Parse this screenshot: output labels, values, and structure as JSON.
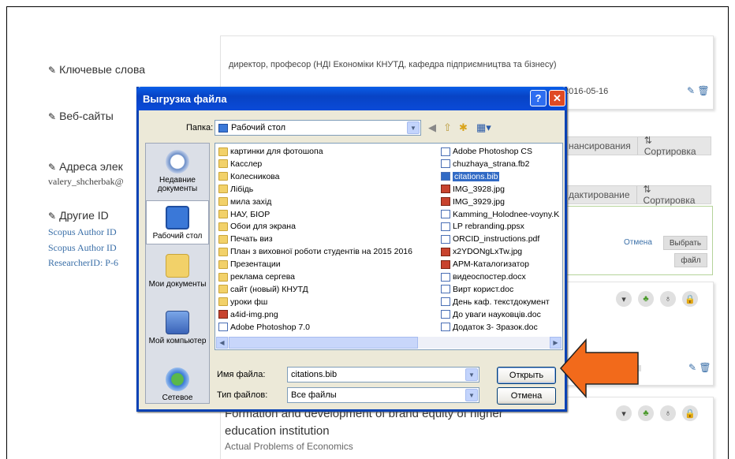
{
  "background": {
    "sections": {
      "keywords": "Ключевые слова",
      "websites": "Веб-сайты",
      "emails": "Адреса элек",
      "other_ids": "Другие ID"
    },
    "email_value": "valery_shcherbak@",
    "id_links": [
      "Scopus Author ID",
      "Scopus Author ID",
      "ResearcherID: P-6"
    ],
    "employment_text": "директор, професор (НДІ Економіки КНУТД, кафедра підприємництва та бізнесу)",
    "date_text": "2016-05-16",
    "funding_bar": {
      "left": "нансирования",
      "right": "⇅ Сортировка"
    },
    "works_bar": {
      "left": "дактирование",
      "right": "⇅ Сортировка"
    },
    "import_panel": {
      "cancel": "Отмена",
      "choose": "Выбрать",
      "file": "файл"
    },
    "paper": {
      "title_line1": "Formation and development of brand equity of higher",
      "title_line2": "education institution",
      "journal": "Actual Problems of Economics"
    }
  },
  "dialog": {
    "title": "Выгрузка файла",
    "help_glyph": "?",
    "close_glyph": "✕",
    "folder_label": "Папка:",
    "folder_value": "Рабочий стол",
    "places": [
      {
        "label": "Недавние документы",
        "icon": "recent-icon"
      },
      {
        "label": "Рабочий стол",
        "icon": "desktop-icon"
      },
      {
        "label": "Мои документы",
        "icon": "my-documents-icon"
      },
      {
        "label": "Мой компьютер",
        "icon": "my-computer-icon"
      },
      {
        "label": "Сетевое",
        "icon": "network-icon"
      }
    ],
    "files_col1": [
      {
        "name": "картинки для фотошопа",
        "type": "folder"
      },
      {
        "name": "Касслер",
        "type": "folder"
      },
      {
        "name": "Колесникова",
        "type": "folder"
      },
      {
        "name": "Лібідь",
        "type": "folder"
      },
      {
        "name": "мила захід",
        "type": "folder"
      },
      {
        "name": "НАУ, БІОР",
        "type": "folder"
      },
      {
        "name": "Обои для экрана",
        "type": "folder"
      },
      {
        "name": "Печать виз",
        "type": "folder"
      },
      {
        "name": "План з виховної роботи студентів на 2015 2016",
        "type": "folder"
      },
      {
        "name": "Презентации",
        "type": "folder"
      },
      {
        "name": "реклама сергева",
        "type": "folder"
      },
      {
        "name": "сайт (новый) КНУТД",
        "type": "folder"
      },
      {
        "name": "уроки фш",
        "type": "folder"
      },
      {
        "name": "a4id-img.png",
        "type": "img"
      },
      {
        "name": "Adobe Photoshop 7.0",
        "type": "doc"
      }
    ],
    "files_col2": [
      {
        "name": "Adobe Photoshop CS",
        "type": "doc"
      },
      {
        "name": "chuzhaya_strana.fb2",
        "type": "doc"
      },
      {
        "name": "citations.bib",
        "type": "doc",
        "selected": true
      },
      {
        "name": "IMG_3928.jpg",
        "type": "img"
      },
      {
        "name": "IMG_3929.jpg",
        "type": "img"
      },
      {
        "name": "Kamming_Holodnee-voyny.K",
        "type": "doc"
      },
      {
        "name": "LP rebranding.ppsx",
        "type": "doc"
      },
      {
        "name": "ORCID_instructions.pdf",
        "type": "doc"
      },
      {
        "name": "x2YDONgLxTw.jpg",
        "type": "img"
      },
      {
        "name": "АРМ-Каталогизатор",
        "type": "img"
      },
      {
        "name": "видеоспостер.docx",
        "type": "doc"
      },
      {
        "name": "Вирт корист.doc",
        "type": "doc"
      },
      {
        "name": "День каф. текстдокумент",
        "type": "doc"
      },
      {
        "name": "До уваги науковців.doc",
        "type": "doc"
      },
      {
        "name": "Додаток 3- Зразок.doc",
        "type": "doc"
      }
    ],
    "filename_label": "Имя файла:",
    "filename_value": "citations.bib",
    "filetype_label": "Тип файлов:",
    "filetype_value": "Все файлы",
    "open_button": "Открыть",
    "cancel_button": "Отмена"
  },
  "colors": {
    "arrow": "#f26a1b",
    "titlebar": "#0a4ad8",
    "link": "#3a6fa8"
  }
}
